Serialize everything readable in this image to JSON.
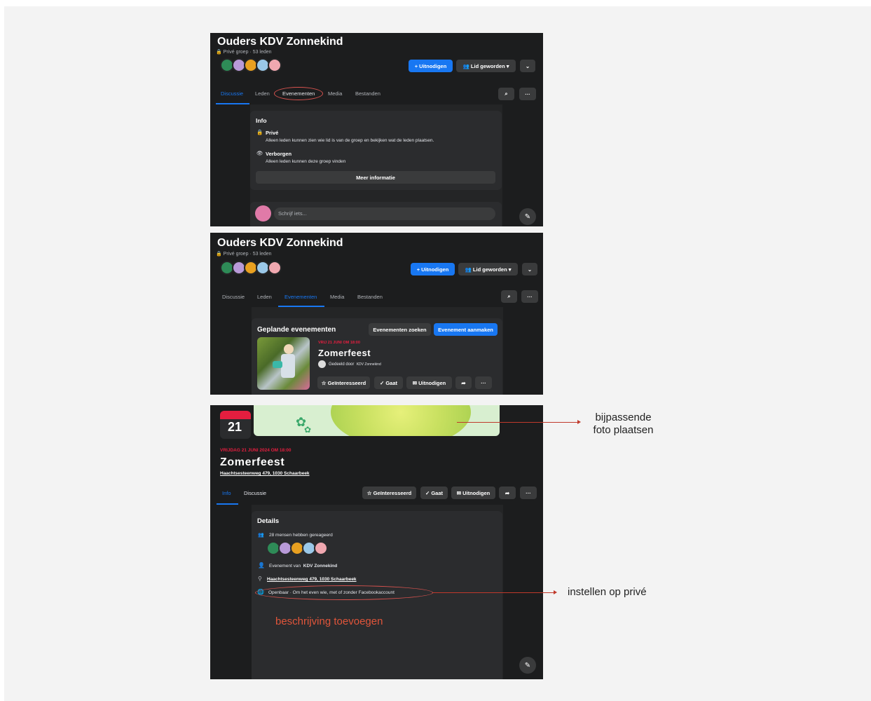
{
  "group": {
    "title": "Ouders KDV Zonnekind",
    "subtitle": "Privé groep · 53 leden",
    "invite_label": "+ Uitnodigen",
    "member_label": "Lid geworden",
    "tabs": [
      "Discussie",
      "Leden",
      "Evenementen",
      "Media",
      "Bestanden"
    ]
  },
  "info_card": {
    "heading": "Info",
    "private_title": "Privé",
    "private_desc": "Alleen leden kunnen zien wie lid is van de groep en bekijken wat de leden plaatsen.",
    "hidden_title": "Verborgen",
    "hidden_desc": "Alleen leden kunnen deze groep vinden",
    "more_button": "Meer informatie",
    "composer_placeholder": "Schrijf iets..."
  },
  "events": {
    "heading": "Geplande evenementen",
    "search_button": "Evenementen zoeken",
    "create_button": "Evenement aanmaken",
    "event_date": "VRIJ 21 JUNI OM 18:00",
    "event_title": "Zomerfeest",
    "shared_by": "Gedeeld door",
    "shared_by_name": "KDV Zonnekind",
    "interested": "Geïnteresseerd",
    "going": "Gaat",
    "invite": "Uitnodigen",
    "more": "···"
  },
  "event_page": {
    "day_number": "21",
    "date_line": "VRIJDAG 21 JUNI 2024 OM 18:00",
    "title": "Zomerfeest",
    "address": "Haachtsesteenweg 479, 1030 Schaarbeek",
    "tabs": [
      "Info",
      "Discussie"
    ],
    "interested": "Geïnteresseerd",
    "going": "Gaat",
    "invite": "Uitnodigen",
    "details_heading": "Details",
    "reacted": "28 mensen hebben gereageerd",
    "organizer_prefix": "Evenement van",
    "organizer": "KDV Zonnekind",
    "visibility": "Openbaar · Om het even wie, met of zonder Facebookaccount",
    "add_description": "beschrijving toevoegen"
  },
  "annotations": {
    "photo": "bijpassende\nfoto plaatsen",
    "privacy": "instellen op privé"
  },
  "colors": {
    "fb_blue": "#1877f2",
    "panel_bg": "#242526",
    "event_red": "#e41e3f",
    "annotation_red": "#d9534f"
  },
  "avatar_colors": [
    "#2e8b57",
    "#b89ad8",
    "#e8a020",
    "#9ac8e8",
    "#f0a8b0"
  ]
}
